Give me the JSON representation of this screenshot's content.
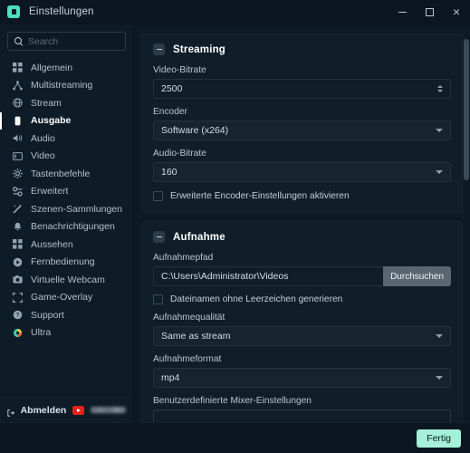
{
  "window": {
    "title": "Einstellungen",
    "app_icon": "app-logo-icon",
    "minimize_label": "",
    "maximize_label": "",
    "close_label": "×"
  },
  "sidebar": {
    "search": {
      "placeholder": "Search",
      "value": ""
    },
    "items": [
      {
        "label": "Allgemein",
        "icon": "grid-icon",
        "active": false
      },
      {
        "label": "Multistreaming",
        "icon": "share-nodes-icon",
        "active": false
      },
      {
        "label": "Stream",
        "icon": "globe-icon",
        "active": false
      },
      {
        "label": "Ausgabe",
        "icon": "output-icon",
        "active": true
      },
      {
        "label": "Audio",
        "icon": "speaker-icon",
        "active": false
      },
      {
        "label": "Video",
        "icon": "monitor-icon",
        "active": false
      },
      {
        "label": "Tastenbefehle",
        "icon": "gear-icon",
        "active": false
      },
      {
        "label": "Erweitert",
        "icon": "sliders-icon",
        "active": false
      },
      {
        "label": "Szenen-Sammlungen",
        "icon": "wand-icon",
        "active": false
      },
      {
        "label": "Benachrichtigungen",
        "icon": "bell-icon",
        "active": false
      },
      {
        "label": "Aussehen",
        "icon": "grid-icon",
        "active": false
      },
      {
        "label": "Fernbedienung",
        "icon": "remote-play-icon",
        "active": false
      },
      {
        "label": "Virtuelle Webcam",
        "icon": "camera-icon",
        "active": false
      },
      {
        "label": "Game-Overlay",
        "icon": "expand-icon",
        "active": false
      },
      {
        "label": "Support",
        "icon": "help-circle-icon",
        "active": false
      },
      {
        "label": "Ultra",
        "icon": "ultra-icon",
        "active": false
      }
    ],
    "footer": {
      "logout_label": "Abmelden",
      "logout_icon": "logout-icon",
      "platform_icon": "youtube-icon",
      "account_name": ""
    }
  },
  "main": {
    "sections": [
      {
        "title": "Streaming",
        "collapse_icon": "minus-box-icon",
        "fields": [
          {
            "label": "Video-Bitrate",
            "value": "2500",
            "type": "number"
          },
          {
            "label": "Encoder",
            "value": "Software (x264)",
            "type": "select"
          },
          {
            "label": "Audio-Bitrate",
            "value": "160",
            "type": "select"
          }
        ],
        "checkbox": {
          "label": "Erweiterte Encoder-Einstellungen aktivieren",
          "checked": false
        }
      },
      {
        "title": "Aufnahme",
        "collapse_icon": "minus-box-icon",
        "path_field": {
          "label": "Aufnahmepfad",
          "value": "C:\\Users\\Administrator\\Videos",
          "browse_label": "Durchsuchen"
        },
        "checkbox": {
          "label": "Dateinamen ohne Leerzeichen generieren",
          "checked": false
        },
        "fields": [
          {
            "label": "Aufnahmequalität",
            "value": "Same as stream",
            "type": "select"
          },
          {
            "label": "Aufnahmeformat",
            "value": "mp4",
            "type": "select"
          }
        ],
        "mixer_field": {
          "label": "Benutzerdefinierte Mixer-Einstellungen",
          "value": ""
        }
      }
    ]
  },
  "footer": {
    "done_label": "Fertig"
  },
  "colors": {
    "accent": "#a4f0d8",
    "app_icon": "#4ee0c0",
    "panel_bg": "#101e29",
    "window_bg": "#0d1a24",
    "sidebar_bg": "#0e1c27",
    "youtube_red": "#e62117"
  }
}
